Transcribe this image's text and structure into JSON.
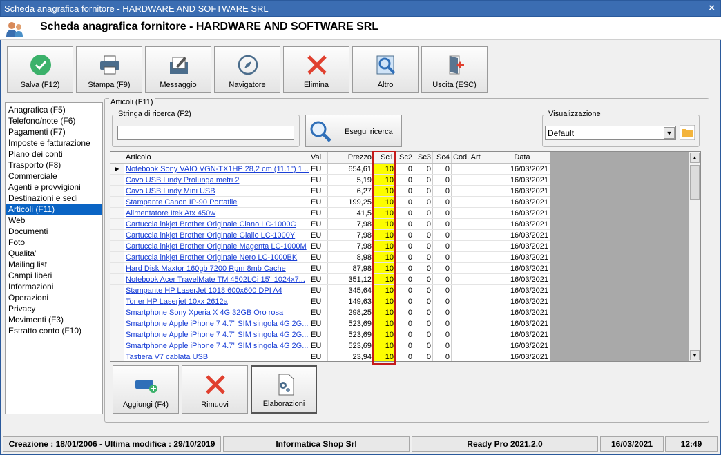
{
  "window": {
    "title": "Scheda anagrafica fornitore - HARDWARE AND SOFTWARE SRL",
    "close": "×"
  },
  "header": {
    "title": "Scheda anagrafica fornitore - HARDWARE AND SOFTWARE SRL",
    "icon": "users-icon"
  },
  "toolbar": {
    "salva": "Salva (F12)",
    "stampa": "Stampa (F9)",
    "messaggio": "Messaggio",
    "navigatore": "Navigatore",
    "elimina": "Elimina",
    "altro": "Altro",
    "uscita": "Uscita (ESC)"
  },
  "sidebar": {
    "items": [
      "Anagrafica (F5)",
      "Telefono/note (F6)",
      "Pagamenti (F7)",
      "Imposte e fatturazione",
      "Piano dei conti",
      "Trasporto (F8)",
      "Commerciale",
      "Agenti e provvigioni",
      "Destinazioni e sedi",
      "Articoli (F11)",
      "Web",
      "Documenti",
      "Foto",
      "Qualita'",
      "Mailing list",
      "Campi liberi",
      "Informazioni",
      "Operazioni",
      "Privacy",
      "Movimenti (F3)",
      "Estratto conto (F10)"
    ],
    "selected_index": 9
  },
  "articoli": {
    "group_label": "Articoli (F11)",
    "search_label": "Stringa di ricerca (F2)",
    "search_value": "",
    "search_button": "Esegui ricerca",
    "view_label": "Visualizzazione",
    "view_value": "Default",
    "columns": [
      "Articolo",
      "Val",
      "Prezzo",
      "Sc1",
      "Sc2",
      "Sc3",
      "Sc4",
      "Cod. Art",
      "Data"
    ],
    "rows": [
      [
        "Notebook Sony VAIO VGN-TX1HP 28,2 cm (11.1\") 1 ...",
        "EU",
        "654,61",
        "10",
        "0",
        "0",
        "0",
        "",
        "16/03/2021"
      ],
      [
        "Cavo USB Lindy Prolunga metri 2",
        "EU",
        "5,19",
        "10",
        "0",
        "0",
        "0",
        "",
        "16/03/2021"
      ],
      [
        "Cavo USB Lindy Mini USB",
        "EU",
        "6,27",
        "10",
        "0",
        "0",
        "0",
        "",
        "16/03/2021"
      ],
      [
        "Stampante Canon IP-90 Portatile",
        "EU",
        "199,25",
        "10",
        "0",
        "0",
        "0",
        "",
        "16/03/2021"
      ],
      [
        "Alimentatore Itek Atx 450w",
        "EU",
        "41,5",
        "10",
        "0",
        "0",
        "0",
        "",
        "16/03/2021"
      ],
      [
        "Cartuccia inkjet Brother Originale Ciano LC-1000C",
        "EU",
        "7,98",
        "10",
        "0",
        "0",
        "0",
        "",
        "16/03/2021"
      ],
      [
        "Cartuccia inkjet Brother Originale Giallo LC-1000Y",
        "EU",
        "7,98",
        "10",
        "0",
        "0",
        "0",
        "",
        "16/03/2021"
      ],
      [
        "Cartuccia inkjet Brother Originale Magenta LC-1000M",
        "EU",
        "7,98",
        "10",
        "0",
        "0",
        "0",
        "",
        "16/03/2021"
      ],
      [
        "Cartuccia inkjet Brother Originale Nero LC-1000BK",
        "EU",
        "8,98",
        "10",
        "0",
        "0",
        "0",
        "",
        "16/03/2021"
      ],
      [
        "Hard Disk Maxtor 160gb 7200 Rpm 8mb Cache",
        "EU",
        "87,98",
        "10",
        "0",
        "0",
        "0",
        "",
        "16/03/2021"
      ],
      [
        "Notebook Acer TravelMate TM 4502LCi 15\" 1024x7...",
        "EU",
        "351,12",
        "10",
        "0",
        "0",
        "0",
        "",
        "16/03/2021"
      ],
      [
        "Stampante HP LaserJet 1018 600x600 DPI A4",
        "EU",
        "345,64",
        "10",
        "0",
        "0",
        "0",
        "",
        "16/03/2021"
      ],
      [
        "Toner HP Laserjet 10xx 2612a",
        "EU",
        "149,63",
        "10",
        "0",
        "0",
        "0",
        "",
        "16/03/2021"
      ],
      [
        "Smartphone Sony Xperia X 4G 32GB Oro rosa",
        "EU",
        "298,25",
        "10",
        "0",
        "0",
        "0",
        "",
        "16/03/2021"
      ],
      [
        "Smartphone Apple iPhone 7 4.7\" SIM singola 4G 2G...",
        "EU",
        "523,69",
        "10",
        "0",
        "0",
        "0",
        "",
        "16/03/2021"
      ],
      [
        "Smartphone Apple iPhone 7 4.7\" SIM singola 4G 2G...",
        "EU",
        "523,69",
        "10",
        "0",
        "0",
        "0",
        "",
        "16/03/2021"
      ],
      [
        "Smartphone Apple iPhone 7 4.7\" SIM singola 4G 2G...",
        "EU",
        "523,69",
        "10",
        "0",
        "0",
        "0",
        "",
        "16/03/2021"
      ],
      [
        "Tastiera V7 cablata USB",
        "EU",
        "23,94",
        "10",
        "0",
        "0",
        "0",
        "",
        "16/03/2021"
      ]
    ],
    "aggiungi": "Aggiungi (F4)",
    "rimuovi": "Rimuovi",
    "elaborazioni": "Elaborazioni"
  },
  "status": {
    "creazione": "Creazione : 18/01/2006 - Ultima modifica : 29/10/2019",
    "company": "Informatica Shop Srl",
    "version": "Ready Pro 2021.2.0",
    "date": "16/03/2021",
    "time": "12:49"
  },
  "colors": {
    "title_bar": "#3b6db2",
    "selection": "#0a64c4",
    "highlight_column": "#fdfd00",
    "highlight_border": "#c41a1a"
  }
}
